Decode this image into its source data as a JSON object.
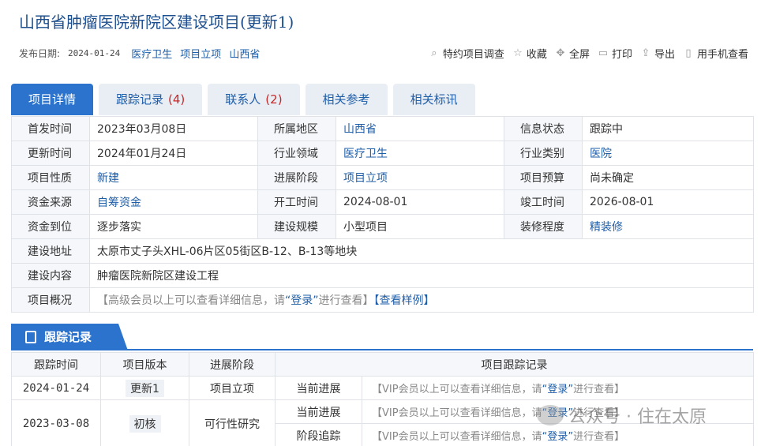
{
  "title": "山西省肿瘤医院新院区建设项目(更新1)",
  "meta": {
    "date_label": "发布日期:",
    "date": "2024-01-24",
    "tags": [
      "医疗卫生",
      "项目立项",
      "山西省"
    ]
  },
  "actions": [
    {
      "icon": "search-icon",
      "glyph": "⌕",
      "label": "特约项目调查"
    },
    {
      "icon": "star-icon",
      "glyph": "☆",
      "label": "收藏"
    },
    {
      "icon": "fullscreen-icon",
      "glyph": "✥",
      "label": "全屏"
    },
    {
      "icon": "print-icon",
      "glyph": "▭",
      "label": "打印"
    },
    {
      "icon": "export-icon",
      "glyph": "⇪",
      "label": "导出"
    },
    {
      "icon": "phone-icon",
      "glyph": "▯",
      "label": "用手机查看"
    }
  ],
  "tabs": [
    {
      "label": "项目详情",
      "count": "",
      "active": true
    },
    {
      "label": "跟踪记录",
      "count": "(4)",
      "active": false
    },
    {
      "label": "联系人",
      "count": "(2)",
      "active": false
    },
    {
      "label": "相关参考",
      "count": "",
      "active": false
    },
    {
      "label": "相关标讯",
      "count": "",
      "active": false
    }
  ],
  "detail": {
    "rows": [
      [
        {
          "label": "首发时间",
          "value": "2023年03月08日"
        },
        {
          "label": "所属地区",
          "value": "山西省",
          "link": true
        },
        {
          "label": "信息状态",
          "value": "跟踪中"
        }
      ],
      [
        {
          "label": "更新时间",
          "value": "2024年01月24日"
        },
        {
          "label": "行业领域",
          "value": "医疗卫生",
          "link": true
        },
        {
          "label": "行业类别",
          "value": "医院",
          "link": true
        }
      ],
      [
        {
          "label": "项目性质",
          "value": "新建",
          "link": true
        },
        {
          "label": "进展阶段",
          "value": "项目立项",
          "link": true
        },
        {
          "label": "项目预算",
          "value": "尚未确定"
        }
      ],
      [
        {
          "label": "资金来源",
          "value": "自筹资金",
          "link": true
        },
        {
          "label": "开工时间",
          "value": "2024-08-01"
        },
        {
          "label": "竣工时间",
          "value": "2026-08-01"
        }
      ],
      [
        {
          "label": "资金到位",
          "value": "逐步落实"
        },
        {
          "label": "建设规模",
          "value": "小型项目"
        },
        {
          "label": "装修程度",
          "value": "精装修",
          "link": true
        }
      ]
    ],
    "address_label": "建设地址",
    "address": "太原市丈子头XHL-06片区05街区B-12、B-13等地块",
    "content_label": "建设内容",
    "content": "肿瘤医院新院区建设工程",
    "overview_label": "项目概况",
    "overview_prefix": "【高级会员以上可以查看详细信息，请",
    "overview_login": "“登录”",
    "overview_suffix": "进行查看】",
    "overview_sample": "【查看样例】"
  },
  "tracking": {
    "section_title": "跟踪记录",
    "headers": [
      "跟踪时间",
      "项目版本",
      "进展阶段",
      "项目跟踪记录"
    ],
    "vip_prefix": "【VIP会员以上可以查看详细信息，请",
    "vip_login": "“登录”",
    "vip_suffix": "进行查看】",
    "rows": [
      {
        "date": "2024-01-24",
        "version": "更新1",
        "stage": "项目立项",
        "records": [
          "当前进展"
        ]
      },
      {
        "date": "2023-03-08",
        "version": "初核",
        "stage": "可行性研究",
        "records": [
          "当前进展",
          "阶段追踪"
        ]
      }
    ]
  },
  "watermark": "公众号 · 住在太原"
}
